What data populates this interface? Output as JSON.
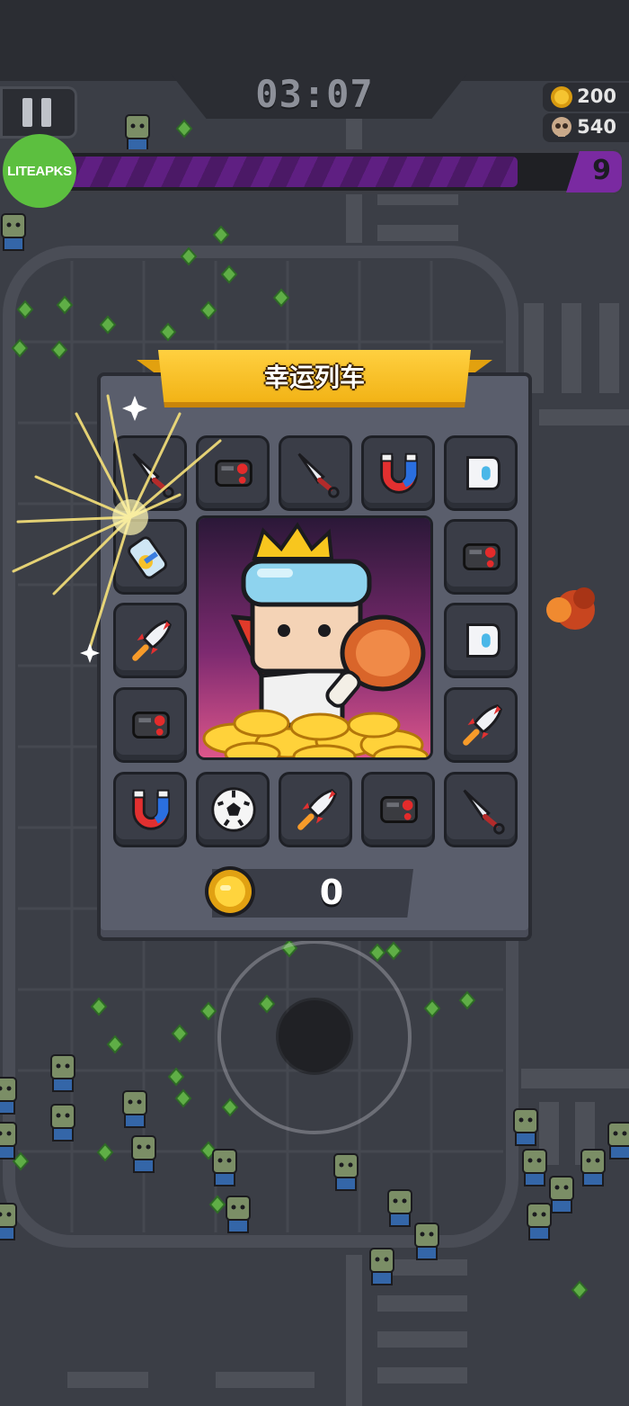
{
  "hud": {
    "timer": "03:07",
    "coins": "200",
    "kills": "540",
    "level": "9",
    "xp_progress": 0.9
  },
  "watermark": "LITEAPKS",
  "panel": {
    "title": "幸运列车",
    "coin_total": "0",
    "slots": [
      {
        "name": "kunai-icon"
      },
      {
        "name": "drone-icon"
      },
      {
        "name": "kunai-icon"
      },
      {
        "name": "magnet-icon"
      },
      {
        "name": "armor-icon"
      },
      {
        "name": "battery-icon"
      },
      {
        "name": "drone-icon"
      },
      {
        "name": "rocket-icon"
      },
      {
        "name": "armor-icon"
      },
      {
        "name": "drone-icon"
      },
      {
        "name": "rocket-icon"
      },
      {
        "name": "magnet-icon"
      },
      {
        "name": "soccer-ball-icon"
      },
      {
        "name": "rocket-icon"
      },
      {
        "name": "drone-icon"
      },
      {
        "name": "kunai-icon"
      }
    ],
    "colors": {
      "ribbon": "#f5b71c",
      "panel": "#5a5e6c",
      "slot": "#3a3d47"
    }
  }
}
